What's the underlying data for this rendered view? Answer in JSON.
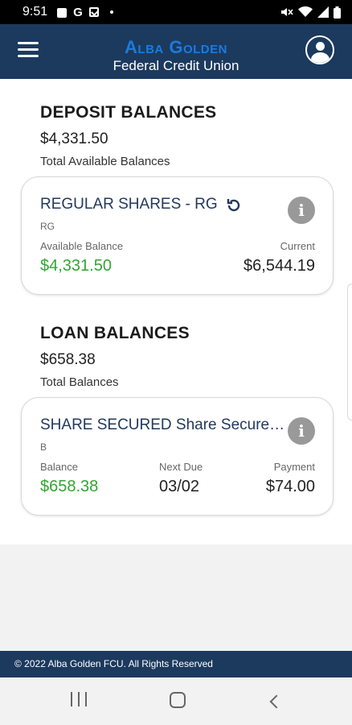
{
  "status_bar": {
    "time": "9:51",
    "left_icons": [
      "shopping-bag-icon",
      "google-icon",
      "checkbox-icon",
      "dot-icon"
    ],
    "g_glyph": "G",
    "right_icons": [
      "mute-icon",
      "wifi-icon",
      "signal-icon",
      "battery-icon"
    ]
  },
  "header": {
    "brand_name": "Alba Golden",
    "brand_sub": "Federal Credit Union",
    "menu_icon": "hamburger-icon",
    "profile_icon": "user-circle-icon"
  },
  "deposit": {
    "title": "DEPOSIT BALANCES",
    "total": "$4,331.50",
    "caption": "Total Available Balances",
    "account": {
      "name": "REGULAR SHARES - RG",
      "code": "RG",
      "available_label": "Available Balance",
      "available_value": "$4,331.50",
      "current_label": "Current",
      "current_value": "$6,544.19"
    }
  },
  "loan": {
    "title": "LOAN BALANCES",
    "total": "$658.38",
    "caption": "Total Balances",
    "account": {
      "name": "SHARE SECURED Share Secured Loan",
      "code": "B",
      "balance_label": "Balance",
      "balance_value": "$658.38",
      "next_due_label": "Next Due",
      "next_due_value": "03/02",
      "payment_label": "Payment",
      "payment_value": "$74.00"
    }
  },
  "footer": {
    "text": "© 2022 Alba Golden FCU. All Rights Reserved"
  },
  "colors": {
    "header_bg": "#1c3a5e",
    "brand_blue": "#1a7be0",
    "positive_green": "#33a532",
    "info_gray": "#999999"
  },
  "info_glyph": "i"
}
